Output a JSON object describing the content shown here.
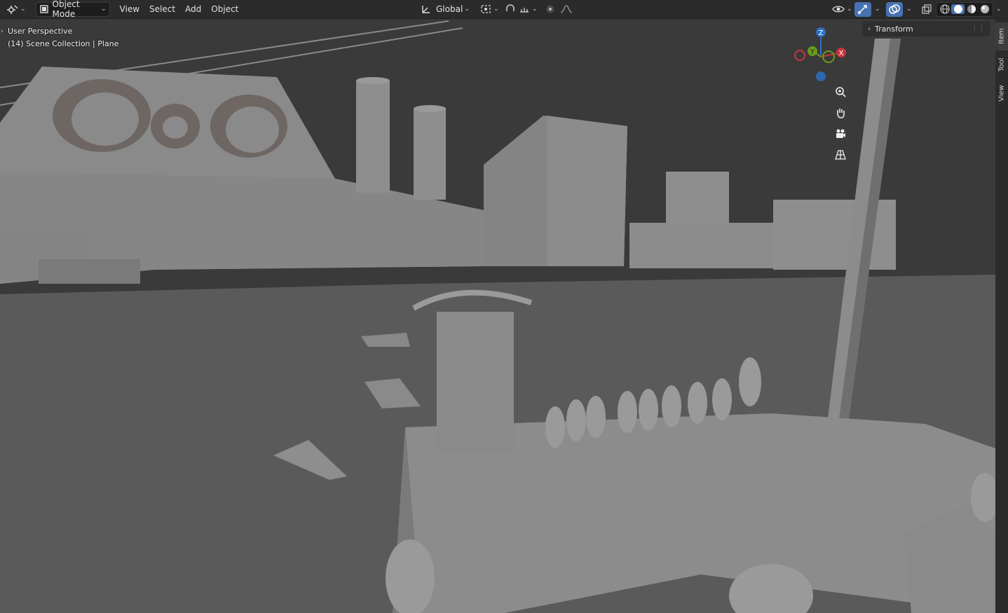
{
  "header": {
    "mode_label": "Object Mode",
    "menus": [
      "View",
      "Select",
      "Add",
      "Object"
    ],
    "orientation_label": "Global",
    "editor_icon": "editor-type-icon",
    "mode_icon": "object-mode-icon",
    "pivot_icon": "pivot-point-icon",
    "snap_icon": "snap-icon",
    "proportional_icon": "proportional-edit-icon",
    "visibility_icon": "eye-icon",
    "gizmo_icon": "gizmo-icon",
    "overlay_icon": "overlay-icon",
    "xray_icon": "xray-icon",
    "shading_modes": [
      "wireframe",
      "solid",
      "material-preview",
      "rendered"
    ],
    "active_shading": "solid",
    "accent": "#4772b3"
  },
  "viewport": {
    "perspective_label": "User Perspective",
    "collection_label": "(14) Scene Collection | Plane"
  },
  "gizmo": {
    "z": "Z",
    "y": "Y",
    "x": "X",
    "colors": {
      "x": "#c9353d",
      "y": "#6b9a1c",
      "z": "#2f6fc2"
    }
  },
  "nav_buttons": [
    "zoom-icon",
    "hand-pan-icon",
    "camera-icon",
    "grid-perspective-icon"
  ],
  "sidebar": {
    "panel_title": "Transform",
    "tabs": [
      "Item",
      "Tool",
      "View"
    ]
  }
}
